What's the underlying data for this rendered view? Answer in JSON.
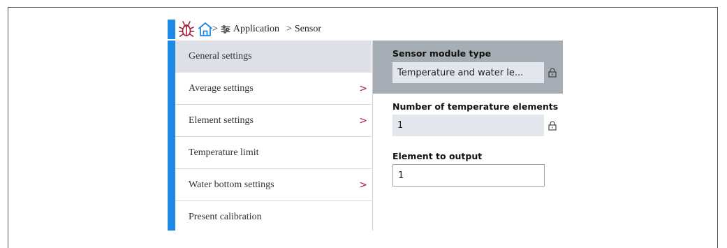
{
  "breadcrumb": {
    "sep1": ">",
    "item1": "Application",
    "sep2": ">",
    "item2": "Sensor"
  },
  "menu": {
    "items": [
      {
        "label": "General settings",
        "active": true,
        "has_submenu": false
      },
      {
        "label": "Average settings",
        "active": false,
        "has_submenu": true
      },
      {
        "label": "Element settings",
        "active": false,
        "has_submenu": true
      },
      {
        "label": "Temperature limit",
        "active": false,
        "has_submenu": false
      },
      {
        "label": "Water bottom settings",
        "active": false,
        "has_submenu": true
      },
      {
        "label": "Present calibration",
        "active": false,
        "has_submenu": false
      }
    ],
    "chevron": ">"
  },
  "fields": {
    "sensor_module_type": {
      "label": "Sensor module type",
      "value": "Temperature and water le..."
    },
    "num_temp_elements": {
      "label": "Number of temperature elements",
      "value": "1"
    },
    "element_to_output": {
      "label": "Element to output",
      "value": "1"
    }
  },
  "colors": {
    "accent": "#1e88e5",
    "chevron": "#a3213c",
    "bug_icon": "#a3213c",
    "home_icon": "#1e88e5",
    "grey_panel": "#a7adb4"
  },
  "icons": [
    "bug-icon",
    "home-icon",
    "filter-icon",
    "lock-icon"
  ]
}
